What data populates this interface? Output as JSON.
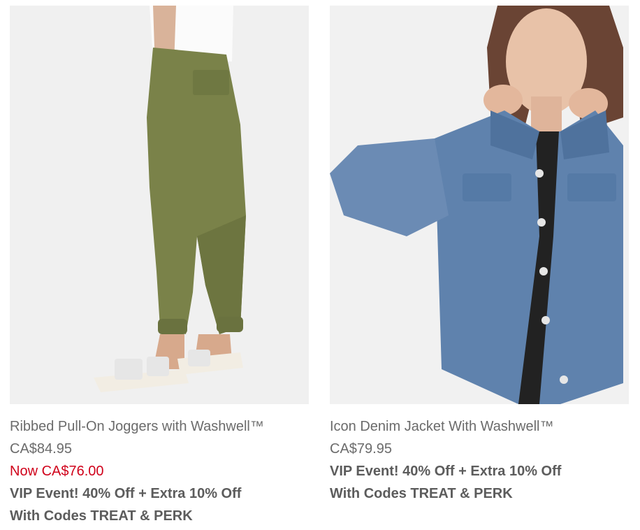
{
  "products": [
    {
      "title": "Ribbed Pull-On Joggers with Washwell™",
      "price": "CA$84.95",
      "sale_price": "Now CA$76.00",
      "promo_line1": "VIP Event! 40% Off + Extra 10% Off",
      "promo_line2": "With Codes TREAT & PERK",
      "image_alt": "olive green joggers with white sandals"
    },
    {
      "title": "Icon Denim Jacket With Washwell™",
      "price": "CA$79.95",
      "promo_line1": "VIP Event! 40% Off + Extra 10% Off",
      "promo_line2": "With Codes TREAT & PERK",
      "image_alt": "woman wearing light denim jacket"
    }
  ],
  "colors": {
    "sale": "#d0021b",
    "text": "#6b6b6b",
    "promo": "#5c5c5c"
  }
}
